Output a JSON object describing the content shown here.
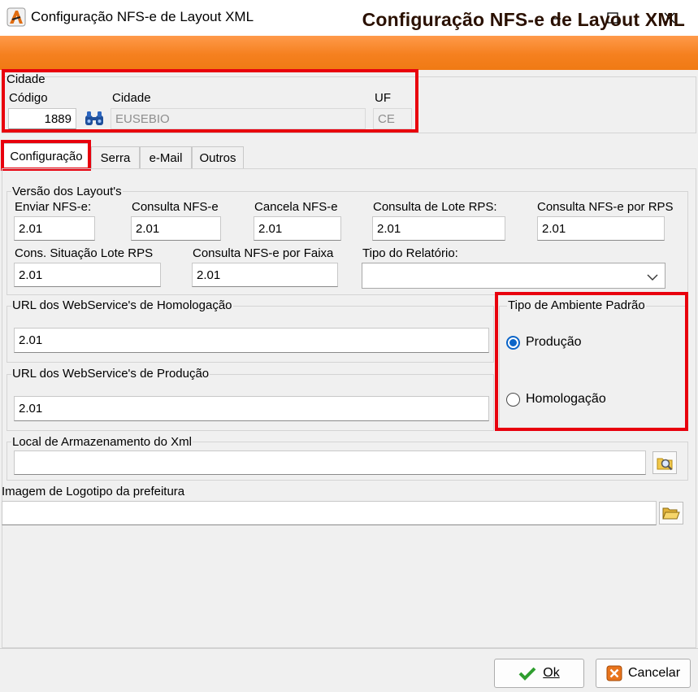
{
  "window": {
    "title": "Configuração NFS-e de Layout XML",
    "banner": "Configuração NFS-e de Layout XML"
  },
  "cidade": {
    "group_label": "Cidade",
    "codigo_label": "Código",
    "codigo_value": "1889",
    "cidade_label": "Cidade",
    "cidade_value": "EUSEBIO",
    "uf_label": "UF",
    "uf_value": "CE"
  },
  "tabs": [
    {
      "label": "Configuração",
      "active": true
    },
    {
      "label": "Serra"
    },
    {
      "label": "e-Mail"
    },
    {
      "label": "Outros"
    }
  ],
  "versao": {
    "group_label": "Versão dos Layout's",
    "fields": [
      {
        "label": "Enviar NFS-e:",
        "value": "2.01"
      },
      {
        "label": "Consulta NFS-e",
        "value": "2.01"
      },
      {
        "label": "Cancela NFS-e",
        "value": "2.01"
      },
      {
        "label": "Consulta de Lote RPS:",
        "value": "2.01"
      },
      {
        "label": "Consulta NFS-e por RPS",
        "value": "2.01"
      },
      {
        "label": "Cons. Situação Lote RPS",
        "value": "2.01"
      },
      {
        "label": "Consulta NFS-e por Faixa",
        "value": "2.01"
      }
    ],
    "tipo_relatorio_label": "Tipo do Relatório:",
    "tipo_relatorio_value": ""
  },
  "url_homologacao": {
    "label": "URL dos WebService's de Homologação",
    "value": "2.01"
  },
  "url_producao": {
    "label": "URL dos WebService's de Produção",
    "value": "2.01"
  },
  "ambiente": {
    "label": "Tipo de Ambiente Padrão",
    "options": [
      {
        "label": "Produção",
        "selected": true
      },
      {
        "label": "Homologação",
        "selected": false
      }
    ]
  },
  "armazenamento": {
    "label": "Local de Armazenamento do Xml",
    "value": ""
  },
  "logotipo": {
    "label": "Imagem de Logotipo da prefeitura",
    "value": ""
  },
  "buttons": {
    "ok": "Ok",
    "cancel": "Cancelar"
  },
  "colors": {
    "banner": "#f5801f",
    "highlight": "#e8000d",
    "radio": "#0a64c8"
  }
}
